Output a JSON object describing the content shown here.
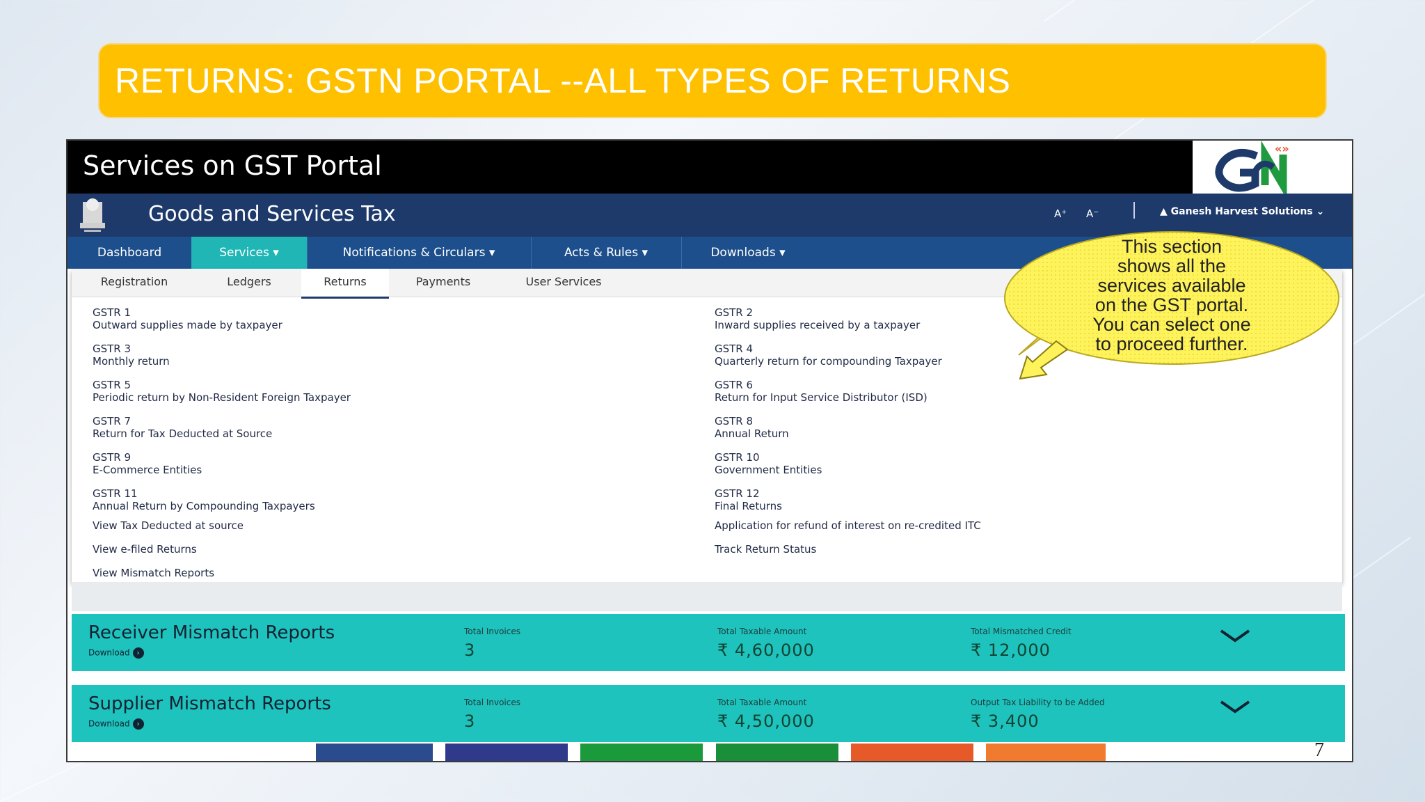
{
  "slide": {
    "title": "RETURNS: GSTN PORTAL --ALL TYPES OF RETURNS",
    "page_number": "7",
    "accent_color": "#ffc000"
  },
  "portal": {
    "window_title": "Services on GST Portal",
    "logo_text": "GSTN",
    "logo_icon": "gstn-logo",
    "emblem_icon": "national-emblem-icon",
    "site_title": "Goods and Services Tax",
    "font_increase": "A⁺",
    "font_decrease": "A⁻",
    "user_name": "Ganesh Harvest Solutions",
    "header_color": "#1d3a6b",
    "nav_color": "#1d4f8c",
    "active_color": "#1fb6b5"
  },
  "main_nav": [
    {
      "label": "Dashboard"
    },
    {
      "label": "Services ▾"
    },
    {
      "label": "Notifications & Circulars ▾"
    },
    {
      "label": "Acts & Rules ▾"
    },
    {
      "label": "Downloads ▾"
    }
  ],
  "sub_tabs": [
    {
      "label": "Registration"
    },
    {
      "label": "Ledgers"
    },
    {
      "label": "Returns"
    },
    {
      "label": "Payments"
    },
    {
      "label": "User Services"
    }
  ],
  "returns_left": [
    {
      "code": "GSTR 1",
      "desc": "Outward supplies made by taxpayer"
    },
    {
      "code": "GSTR 3",
      "desc": "Monthly return"
    },
    {
      "code": "GSTR 5",
      "desc": "Periodic return by Non-Resident Foreign Taxpayer"
    },
    {
      "code": "GSTR 7",
      "desc": "Return for Tax Deducted at Source"
    },
    {
      "code": "GSTR 9",
      "desc": "E-Commerce Entities"
    },
    {
      "code": "GSTR 11",
      "desc": "Annual Return by Compounding Taxpayers"
    }
  ],
  "returns_right": [
    {
      "code": "GSTR 2",
      "desc": "Inward supplies received by a taxpayer"
    },
    {
      "code": "GSTR 4",
      "desc": "Quarterly return for compounding Taxpayer"
    },
    {
      "code": "GSTR 6",
      "desc": "Return for Input Service Distributor (ISD)"
    },
    {
      "code": "GSTR 8",
      "desc": "Annual Return"
    },
    {
      "code": "GSTR 10",
      "desc": "Government Entities"
    },
    {
      "code": "GSTR 12",
      "desc": "Final Returns"
    }
  ],
  "links_left": [
    "View Tax Deducted at source",
    "View e-filed Returns",
    "View Mismatch Reports"
  ],
  "links_right": [
    "Application for refund of interest on re-credited ITC",
    "Track Return Status"
  ],
  "reports": [
    {
      "title": "Receiver Mismatch Reports",
      "download": "Download",
      "invoices_label": "Total Invoices",
      "invoices_value": "3",
      "taxable_label": "Total Taxable Amount",
      "taxable_value": "₹ 4,60,000",
      "third_label": "Total Mismatched Credit",
      "third_value": "₹ 12,000"
    },
    {
      "title": "Supplier Mismatch Reports",
      "download": "Download",
      "invoices_label": "Total Invoices",
      "invoices_value": "3",
      "taxable_label": "Total Taxable Amount",
      "taxable_value": "₹ 4,50,000",
      "third_label": "Output Tax Liability to be Added",
      "third_value": "₹ 3,400"
    }
  ],
  "report_bg_color": "#1ec3bd",
  "color_strip": [
    "#2b4b8f",
    "#2f3a8a",
    "#1b9a3c",
    "#1a8f3a",
    "#e65a2a",
    "#f07a2e"
  ],
  "callout": {
    "lines": [
      "This section",
      "shows all  the",
      "services available",
      "on the GST portal.",
      "You can select one",
      "to proceed further."
    ],
    "color": "#fff35c"
  }
}
